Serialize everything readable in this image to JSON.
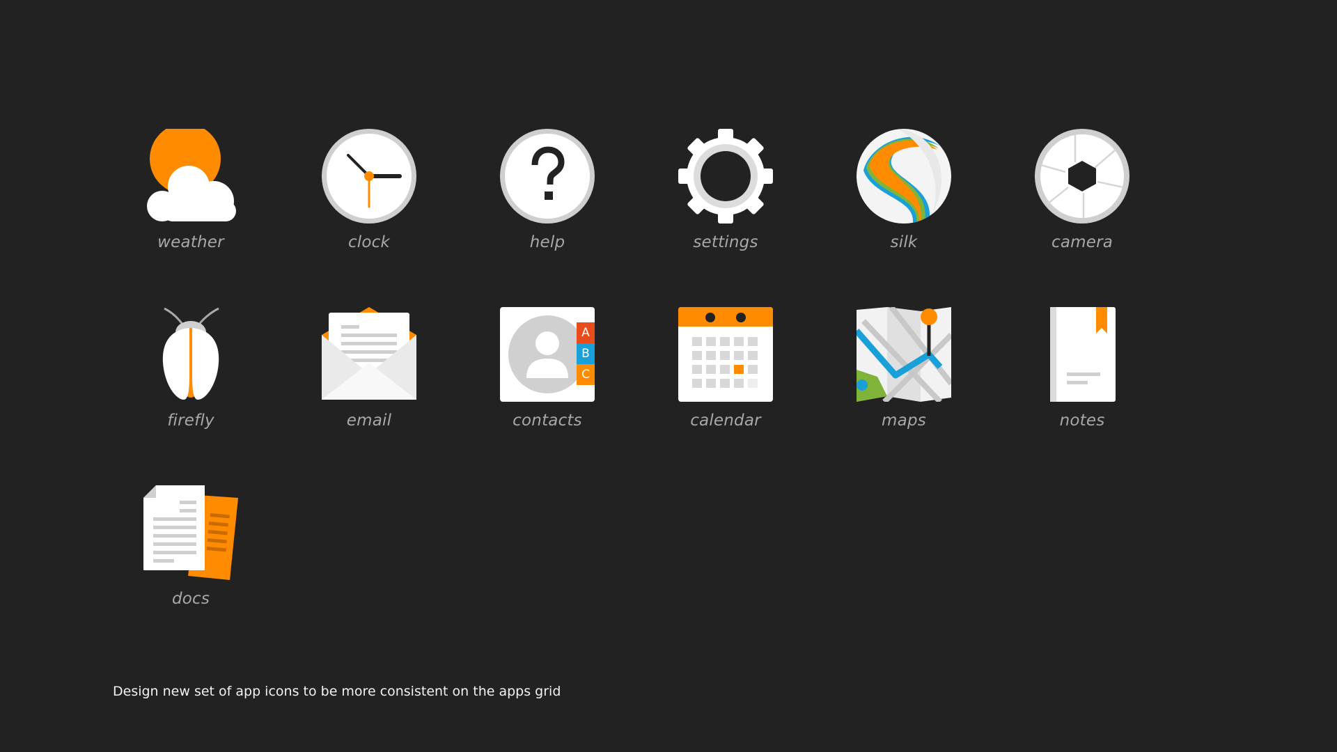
{
  "apps": [
    {
      "id": "weather",
      "label": "weather",
      "icon": "weather-icon"
    },
    {
      "id": "clock",
      "label": "clock",
      "icon": "clock-icon"
    },
    {
      "id": "help",
      "label": "help",
      "icon": "help-icon"
    },
    {
      "id": "settings",
      "label": "settings",
      "icon": "settings-icon"
    },
    {
      "id": "silk",
      "label": "silk",
      "icon": "silk-icon"
    },
    {
      "id": "camera",
      "label": "camera",
      "icon": "camera-icon"
    },
    {
      "id": "firefly",
      "label": "firefly",
      "icon": "firefly-icon"
    },
    {
      "id": "email",
      "label": "email",
      "icon": "email-icon"
    },
    {
      "id": "contacts",
      "label": "contacts",
      "icon": "contacts-icon",
      "tabs": [
        "A",
        "B",
        "C"
      ]
    },
    {
      "id": "calendar",
      "label": "calendar",
      "icon": "calendar-icon"
    },
    {
      "id": "maps",
      "label": "maps",
      "icon": "maps-icon"
    },
    {
      "id": "notes",
      "label": "notes",
      "icon": "notes-icon"
    },
    {
      "id": "docs",
      "label": "docs",
      "icon": "docs-icon"
    }
  ],
  "caption": "Design new set of app icons to be more consistent on the apps grid",
  "colors": {
    "background": "#222222",
    "accent_orange": "#ff8c00",
    "label_gray": "#a8a8a8",
    "caption_white": "#f2f2f2"
  }
}
